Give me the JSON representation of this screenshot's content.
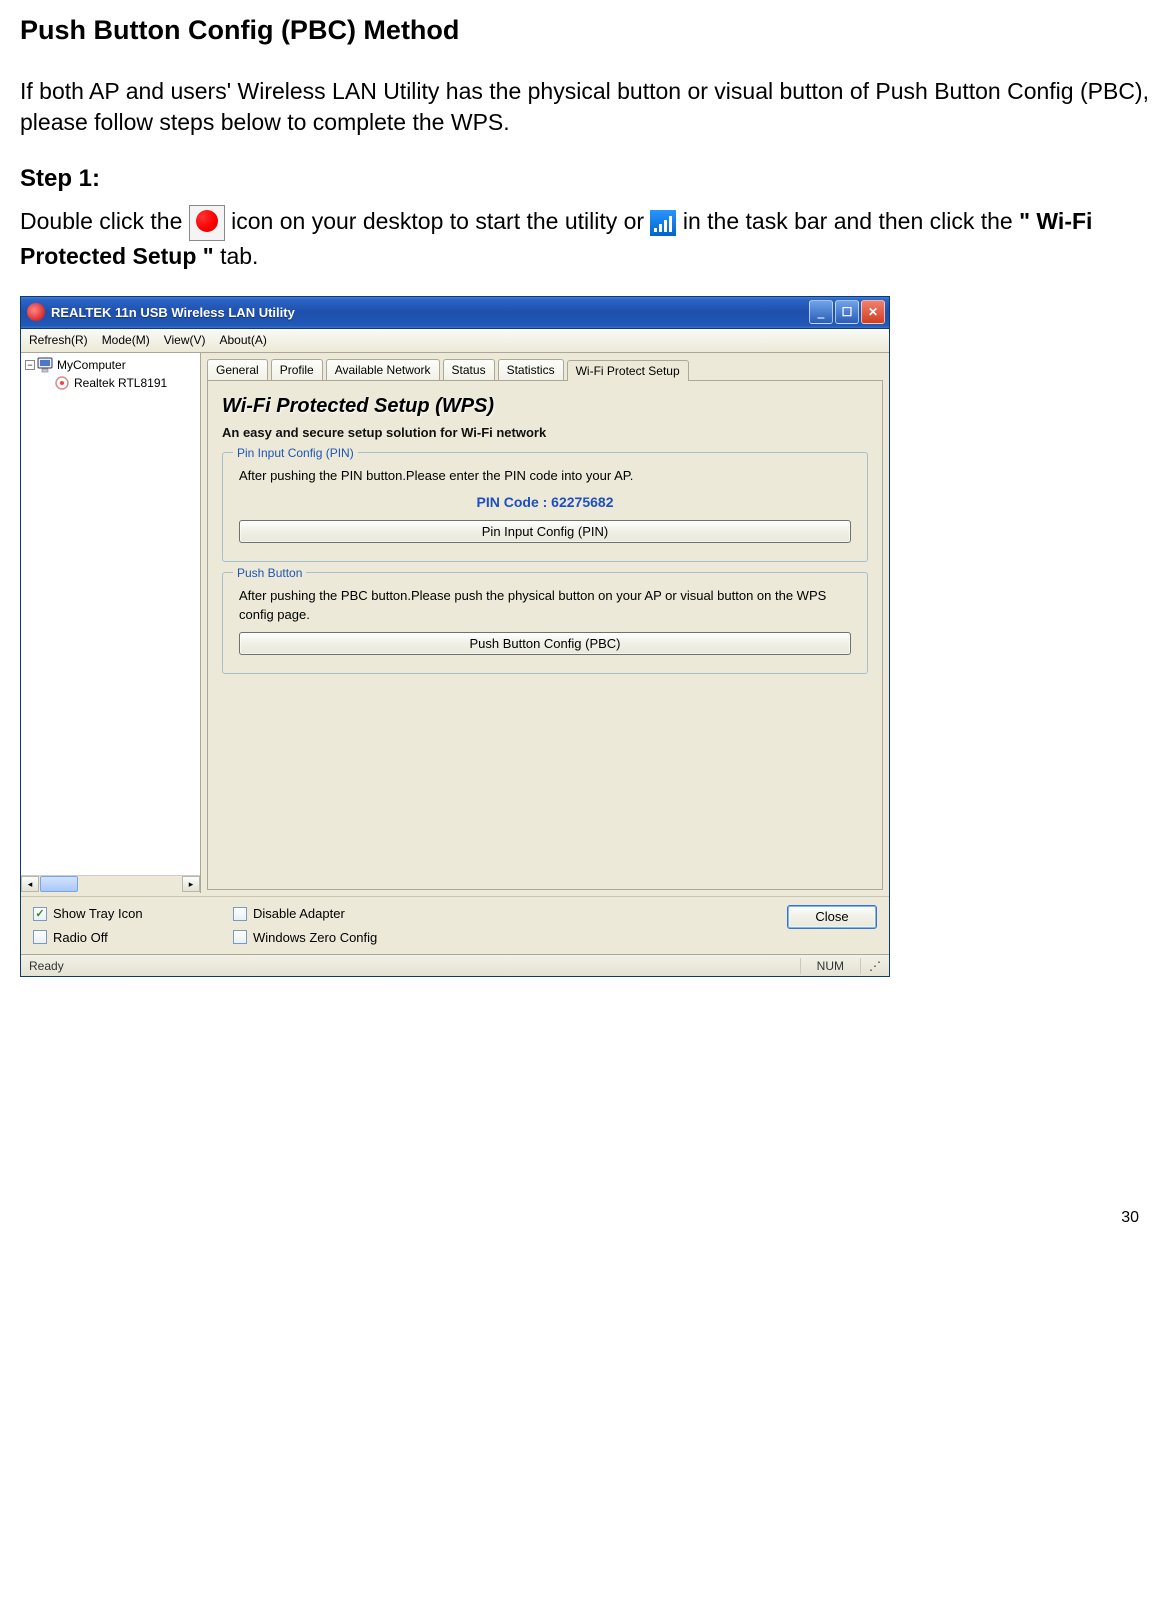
{
  "heading": "Push Button Config (PBC) Method",
  "intro_paragraph": "If both AP and users' Wireless LAN Utility has the physical button or visual button of Push Button Config (PBC), please follow steps below to complete the WPS.",
  "step1": {
    "label": "Step 1:",
    "text_before_icon1": "Double click the ",
    "text_after_icon1": " icon on your desktop to start the utility or ",
    "text_after_icon2": " in the task bar and then click the ",
    "bold_part": "\" Wi-Fi Protected Setup \"",
    "text_tail": " tab."
  },
  "window": {
    "title": "REALTEK 11n USB Wireless LAN Utility",
    "menus": [
      "Refresh(R)",
      "Mode(M)",
      "View(V)",
      "About(A)"
    ],
    "tree": {
      "root": "MyComputer",
      "child": "Realtek RTL8191"
    },
    "tabs": [
      "General",
      "Profile",
      "Available Network",
      "Status",
      "Statistics",
      "Wi-Fi Protect Setup"
    ],
    "active_tab_index": 5,
    "wps": {
      "title": "Wi-Fi Protected Setup (WPS)",
      "subtitle": "An easy and secure setup solution for Wi-Fi network",
      "pin_group": {
        "legend": "Pin Input Config (PIN)",
        "text": "After pushing the PIN button.Please enter the PIN code into your AP.",
        "pin_label": "PIN Code :  62275682",
        "button": "Pin Input Config (PIN)"
      },
      "pbc_group": {
        "legend": "Push Button",
        "text": "After pushing the PBC button.Please push the physical button on your AP or visual button on the WPS config page.",
        "button": "Push Button Config (PBC)"
      }
    },
    "checkboxes": {
      "show_tray": {
        "label": "Show Tray Icon",
        "checked": true
      },
      "radio_off": {
        "label": "Radio Off",
        "checked": false
      },
      "disable_adapter": {
        "label": "Disable Adapter",
        "checked": false
      },
      "win_zero": {
        "label": "Windows Zero Config",
        "checked": false
      }
    },
    "close_button": "Close",
    "status_left": "Ready",
    "status_num": "NUM"
  },
  "page_number": "30"
}
